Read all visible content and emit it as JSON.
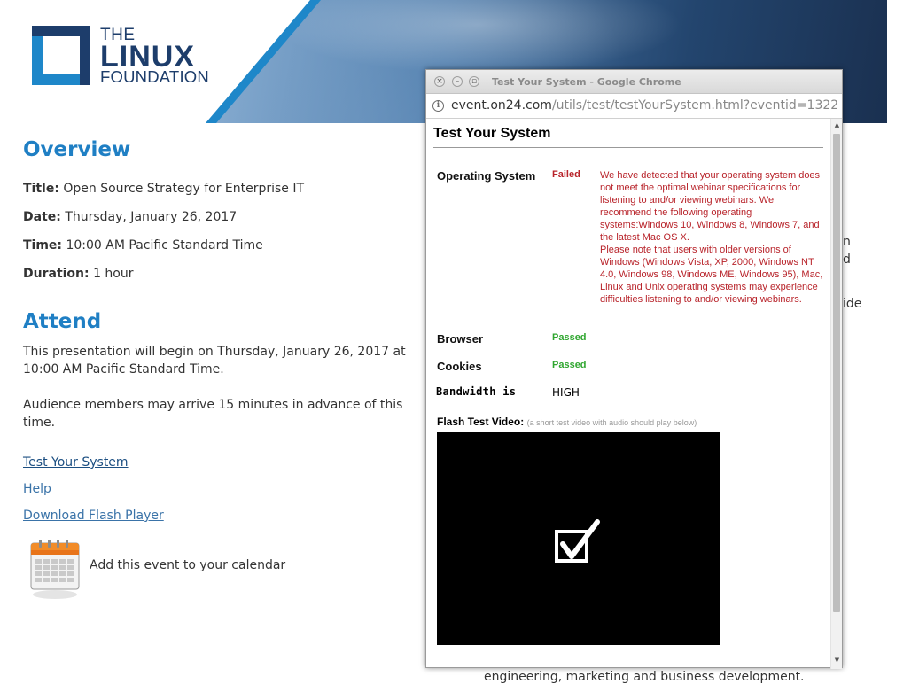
{
  "logo": {
    "line1": "THE",
    "line2": "LINUX",
    "line3": "FOUNDATION"
  },
  "overview": {
    "heading": "Overview",
    "title_label": "Title:",
    "title_value": "Open Source Strategy for Enterprise IT",
    "date_label": "Date:",
    "date_value": "Thursday, January 26, 2017",
    "time_label": "Time:",
    "time_value": "10:00 AM Pacific Standard Time",
    "duration_label": "Duration:",
    "duration_value": "1 hour"
  },
  "attend": {
    "heading": "Attend",
    "para1": "This presentation will begin on Thursday, January 26, 2017 at 10:00 AM Pacific Standard Time.",
    "para2": "Audience members may arrive 15 minutes in advance of this time.",
    "links": [
      "Test Your System",
      "Help",
      "Download Flash Player"
    ],
    "calendar_text": "Add this event to your calendar"
  },
  "background_fragments": [
    "n",
    "d",
    "ide",
    "engineering, marketing and business development."
  ],
  "popup": {
    "window_title": "Test Your System - Google Chrome",
    "url_host": "event.on24.com",
    "url_path": "/utils/test/testYourSystem.html?eventid=1322",
    "heading": "Test Your System",
    "os": {
      "label": "Operating System",
      "status": "Failed",
      "message": "We have detected that your operating system does not meet the optimal webinar specifications for listening to and/or viewing webinars. We recommend the following operating systems:Windows 10, Windows 8, Windows 7, and the latest Mac OS X.\nPlease note that users with older versions of Windows (Windows Vista, XP, 2000, Windows NT 4.0, Windows 98, Windows ME, Windows 95), Mac, Linux and Unix operating systems may experience difficulties listening to and/or viewing webinars."
    },
    "browser": {
      "label": "Browser",
      "status": "Passed"
    },
    "cookies": {
      "label": "Cookies",
      "status": "Passed"
    },
    "bandwidth": {
      "label": "Bandwidth is",
      "value": "HIGH"
    },
    "flash": {
      "label": "Flash Test Video:",
      "note": "(a short test video with audio should play below)"
    }
  },
  "colors": {
    "accent": "#1f7fc4",
    "failed": "#b8232a",
    "passed": "#2fa62f",
    "logo": "#1d3d6b"
  },
  "icons": [
    "linux-foundation-logo-icon",
    "calendar-icon",
    "info-icon",
    "close-icon",
    "minimize-icon",
    "maximize-icon",
    "checkmark-icon",
    "scroll-up-icon",
    "scroll-down-icon"
  ]
}
